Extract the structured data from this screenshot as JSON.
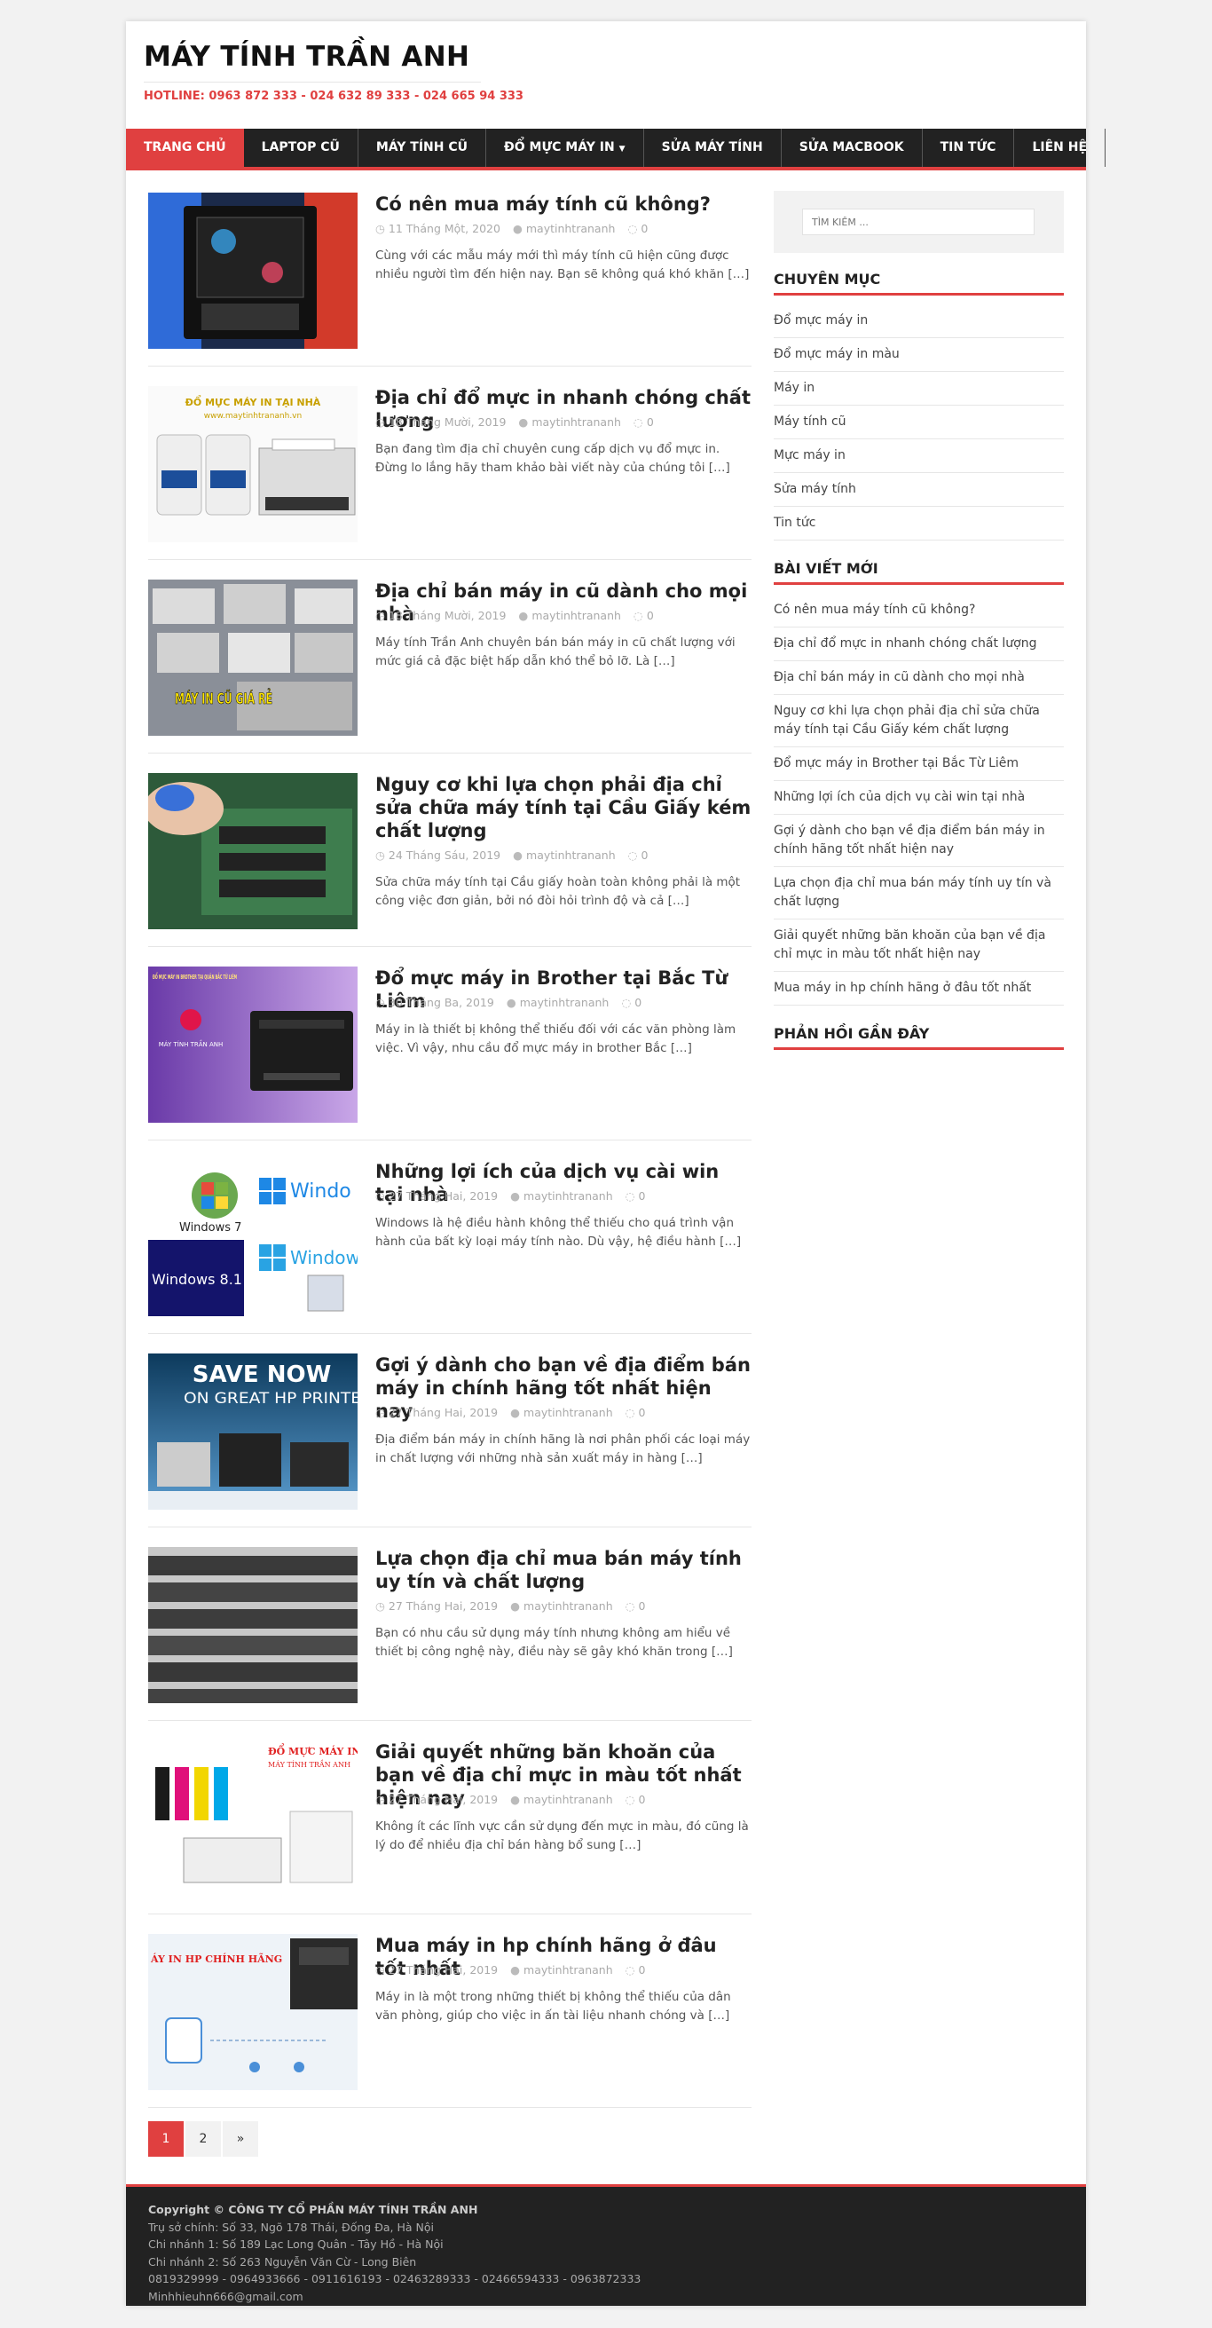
{
  "site": {
    "title": "MÁY TÍNH TRẦN ANH",
    "hotline": "HOTLINE: 0963 872 333 - 024 632 89 333 - 024 665 94 333"
  },
  "nav": {
    "items": [
      {
        "label": "TRANG CHỦ",
        "active": true
      },
      {
        "label": "LAPTOP CŨ"
      },
      {
        "label": "MÁY TÍNH CŨ"
      },
      {
        "label": "ĐỔ MỰC MÁY IN",
        "dropdown": true
      },
      {
        "label": "SỬA MÁY TÍNH"
      },
      {
        "label": "SỬA MACBOOK"
      },
      {
        "label": "TIN TỨC"
      },
      {
        "label": "LIÊN HỆ"
      }
    ]
  },
  "posts": [
    {
      "title": "Có nên mua máy tính cũ không?",
      "date": "11 Tháng Một, 2020",
      "author": "maytinhtrananh",
      "comments": "0",
      "excerpt": "Cùng với các mẫu máy mới thì máy tính cũ hiện cũng được nhiều người tìm đến hiện nay. Bạn sẽ không quá khó khăn […]",
      "thumb": "pc-case"
    },
    {
      "title": "Địa chỉ đổ mực in nhanh chóng chất lượng",
      "date": "18 Tháng Mười, 2019",
      "author": "maytinhtrananh",
      "comments": "0",
      "excerpt": "Bạn đang tìm địa chỉ chuyên cung cấp dịch vụ đổ mực in. Đừng lo lắng hãy tham khảo bài viết này của chúng tôi […]",
      "thumb": "toner-printer",
      "thumb_text": "ĐỔ MỰC MÁY IN TẠI NHÀ",
      "thumb_subtext": "www.maytinhtrananh.vn"
    },
    {
      "title": "Địa chỉ bán máy in cũ dành cho mọi nhà",
      "date": "18 Tháng Mười, 2019",
      "author": "maytinhtrananh",
      "comments": "0",
      "excerpt": "Máy tính Trần Anh chuyên bán bán máy in cũ chất lượng với mức giá cả đặc biệt hấp dẫn khó thể bỏ lỡ. Là […]",
      "thumb": "printers-stack",
      "thumb_text": "MÁY IN CŨ GIÁ RẺ"
    },
    {
      "title": "Nguy cơ khi lựa chọn phải địa chỉ sửa chữa máy tính tại Cầu Giấy kém chất lượng",
      "date": "24 Tháng Sáu, 2019",
      "author": "maytinhtrananh",
      "comments": "0",
      "excerpt": "Sửa chữa máy tính tại Cầu giấy hoàn toàn không phải là một công việc đơn giản, bởi  nó đòi hỏi trình độ và cả […]",
      "thumb": "repair"
    },
    {
      "title": "Đổ mực máy in Brother tại Bắc Từ Liêm",
      "date": "30 Tháng Ba, 2019",
      "author": "maytinhtrananh",
      "comments": "0",
      "excerpt": "Máy in là thiết bị không thể thiếu đối với các văn phòng làm việc. Vì vậy, nhu cầu đổ mực máy in brother Bắc […]",
      "thumb": "brother",
      "thumb_text": "ĐỔ MỰC MÁY IN BROTHER TẠI QUẬN BẮC TỪ LIÊM",
      "thumb_subtext": "MÁY TÍNH TRẦN ANH"
    },
    {
      "title": "Những lợi ích của dịch vụ cài win tại nhà",
      "date": "27 Tháng Hai, 2019",
      "author": "maytinhtrananh",
      "comments": "0",
      "excerpt": "Windows là hệ điều hành không thể thiếu cho quá trình vận hành của bất kỳ loại máy tính nào. Dù vậy, hệ điều hành […]",
      "thumb": "windows",
      "thumb_labels": [
        "Windows 7",
        "Windo",
        "Windows 8.1",
        "Window"
      ]
    },
    {
      "title": "Gợi ý dành cho bạn về địa điểm bán máy in chính hãng tốt nhất hiện nay",
      "date": "27 Tháng Hai, 2019",
      "author": "maytinhtrananh",
      "comments": "0",
      "excerpt": "Địa điểm bán máy in chính hãng là nơi phân phối các loại máy in chất lượng với những nhà sản xuất máy in hàng […]",
      "thumb": "hp-save",
      "thumb_text": "SAVE NOW",
      "thumb_subtext": "ON GREAT HP PRINTE"
    },
    {
      "title": "Lựa chọn địa chỉ mua bán máy tính uy tín và chất lượng",
      "date": "27 Tháng Hai, 2019",
      "author": "maytinhtrananh",
      "comments": "0",
      "excerpt": "Bạn có nhu cầu sử dụng máy tính nhưng không am hiểu về thiết bị công nghệ này, điều này sẽ gây khó khăn trong […]",
      "thumb": "laptops"
    },
    {
      "title": "Giải quyết những băn khoăn của bạn về địa chỉ mực in màu tốt nhất hiện nay",
      "date": "27 Tháng Hai, 2019",
      "author": "maytinhtrananh",
      "comments": "0",
      "excerpt": "Không ít các lĩnh vực cần sử dụng đến mực in màu, đó cũng là lý do để nhiều địa chỉ bán hàng bổ sung […]",
      "thumb": "color-ink",
      "thumb_text": "ĐỔ MỰC MÁY IN M",
      "thumb_subtext": "MÁY TÍNH TRẦN ANH"
    },
    {
      "title": "Mua máy in hp chính hãng ở đâu tốt nhất",
      "date": "27 Tháng Hai, 2019",
      "author": "maytinhtrananh",
      "comments": "0",
      "excerpt": "Máy in là một trong những thiết bị không thể thiếu của dân văn phòng, giúp cho việc in ấn tài liệu nhanh chóng và […]",
      "thumb": "hp-genuine",
      "thumb_text": "ÁY IN HP CHÍNH HÃNG"
    }
  ],
  "pagination": {
    "pages": [
      "1",
      "2",
      "»"
    ],
    "current": "1"
  },
  "sidebar": {
    "search_placeholder": "TÌM KIẾM ...",
    "categories_title": "CHUYÊN MỤC",
    "categories": [
      "Đổ mực máy in",
      "Đổ mực máy in màu",
      "Máy in",
      "Máy tính cũ",
      "Mực máy in",
      "Sửa máy tính",
      "Tin tức"
    ],
    "recent_title": "BÀI VIẾT MỚI",
    "recent": [
      "Có nên mua máy tính cũ không?",
      "Địa chỉ đổ mực in nhanh chóng chất lượng",
      "Địa chỉ bán máy in cũ dành cho mọi nhà",
      "Nguy cơ khi lựa chọn phải địa chỉ sửa chữa máy tính tại Cầu Giấy kém chất lượng",
      "Đổ mực máy in Brother tại Bắc Từ Liêm",
      "Những lợi ích của dịch vụ cài win tại nhà",
      "Gợi ý dành cho bạn về địa điểm bán máy in chính hãng tốt nhất hiện nay",
      "Lựa chọn địa chỉ mua bán máy tính uy tín và chất lượng",
      "Giải quyết những băn khoăn của bạn về địa chỉ mực in màu tốt nhất hiện nay",
      "Mua máy in hp chính hãng ở đâu tốt nhất"
    ],
    "comments_title": "PHẢN HỒI GẦN ĐÂY"
  },
  "footer": {
    "lines": [
      "Copyright © CÔNG TY CỔ PHẦN MÁY TÍNH TRẦN ANH",
      "Trụ sở chính: Số 33, Ngõ 178 Thái, Đống Đa, Hà Nội",
      "Chi nhánh 1: Số 189 Lạc Long Quân - Tây Hồ - Hà Nội",
      "Chi nhánh 2: Số 263 Nguyễn Văn Cừ - Long Biên",
      "0819329999 - 0964933666 - 0911616193 - 02463289333 - 02466594333 - 0963872333",
      "Minhhieuhn666@gmail.com"
    ]
  },
  "colors": {
    "accent": "#e04040",
    "nav_bg": "#222222",
    "footer_bg": "#222222"
  }
}
